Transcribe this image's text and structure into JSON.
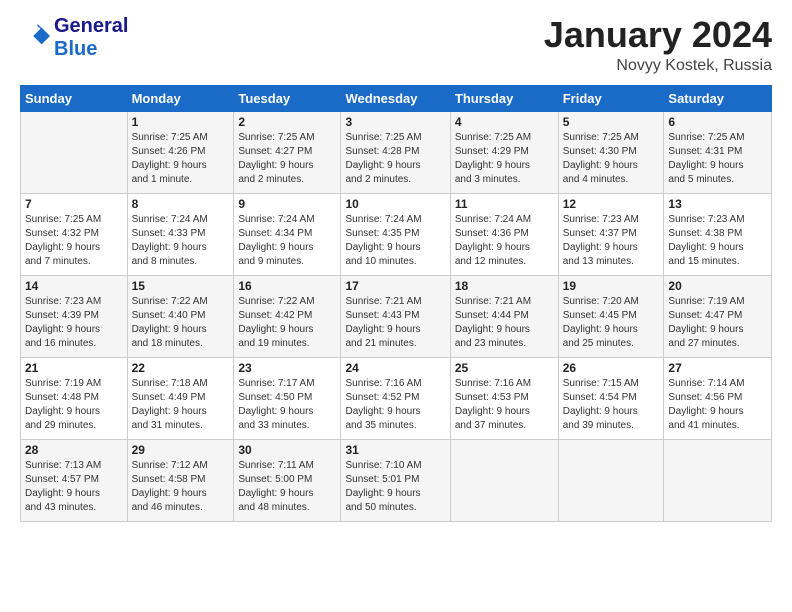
{
  "logo": {
    "line1": "General",
    "line2": "Blue"
  },
  "title": "January 2024",
  "subtitle": "Novyy Kostek, Russia",
  "header": {
    "days": [
      "Sunday",
      "Monday",
      "Tuesday",
      "Wednesday",
      "Thursday",
      "Friday",
      "Saturday"
    ]
  },
  "weeks": [
    [
      {
        "num": "",
        "detail": ""
      },
      {
        "num": "1",
        "detail": "Sunrise: 7:25 AM\nSunset: 4:26 PM\nDaylight: 9 hours\nand 1 minute."
      },
      {
        "num": "2",
        "detail": "Sunrise: 7:25 AM\nSunset: 4:27 PM\nDaylight: 9 hours\nand 2 minutes."
      },
      {
        "num": "3",
        "detail": "Sunrise: 7:25 AM\nSunset: 4:28 PM\nDaylight: 9 hours\nand 2 minutes."
      },
      {
        "num": "4",
        "detail": "Sunrise: 7:25 AM\nSunset: 4:29 PM\nDaylight: 9 hours\nand 3 minutes."
      },
      {
        "num": "5",
        "detail": "Sunrise: 7:25 AM\nSunset: 4:30 PM\nDaylight: 9 hours\nand 4 minutes."
      },
      {
        "num": "6",
        "detail": "Sunrise: 7:25 AM\nSunset: 4:31 PM\nDaylight: 9 hours\nand 5 minutes."
      }
    ],
    [
      {
        "num": "7",
        "detail": "Sunrise: 7:25 AM\nSunset: 4:32 PM\nDaylight: 9 hours\nand 7 minutes."
      },
      {
        "num": "8",
        "detail": "Sunrise: 7:24 AM\nSunset: 4:33 PM\nDaylight: 9 hours\nand 8 minutes."
      },
      {
        "num": "9",
        "detail": "Sunrise: 7:24 AM\nSunset: 4:34 PM\nDaylight: 9 hours\nand 9 minutes."
      },
      {
        "num": "10",
        "detail": "Sunrise: 7:24 AM\nSunset: 4:35 PM\nDaylight: 9 hours\nand 10 minutes."
      },
      {
        "num": "11",
        "detail": "Sunrise: 7:24 AM\nSunset: 4:36 PM\nDaylight: 9 hours\nand 12 minutes."
      },
      {
        "num": "12",
        "detail": "Sunrise: 7:23 AM\nSunset: 4:37 PM\nDaylight: 9 hours\nand 13 minutes."
      },
      {
        "num": "13",
        "detail": "Sunrise: 7:23 AM\nSunset: 4:38 PM\nDaylight: 9 hours\nand 15 minutes."
      }
    ],
    [
      {
        "num": "14",
        "detail": "Sunrise: 7:23 AM\nSunset: 4:39 PM\nDaylight: 9 hours\nand 16 minutes."
      },
      {
        "num": "15",
        "detail": "Sunrise: 7:22 AM\nSunset: 4:40 PM\nDaylight: 9 hours\nand 18 minutes."
      },
      {
        "num": "16",
        "detail": "Sunrise: 7:22 AM\nSunset: 4:42 PM\nDaylight: 9 hours\nand 19 minutes."
      },
      {
        "num": "17",
        "detail": "Sunrise: 7:21 AM\nSunset: 4:43 PM\nDaylight: 9 hours\nand 21 minutes."
      },
      {
        "num": "18",
        "detail": "Sunrise: 7:21 AM\nSunset: 4:44 PM\nDaylight: 9 hours\nand 23 minutes."
      },
      {
        "num": "19",
        "detail": "Sunrise: 7:20 AM\nSunset: 4:45 PM\nDaylight: 9 hours\nand 25 minutes."
      },
      {
        "num": "20",
        "detail": "Sunrise: 7:19 AM\nSunset: 4:47 PM\nDaylight: 9 hours\nand 27 minutes."
      }
    ],
    [
      {
        "num": "21",
        "detail": "Sunrise: 7:19 AM\nSunset: 4:48 PM\nDaylight: 9 hours\nand 29 minutes."
      },
      {
        "num": "22",
        "detail": "Sunrise: 7:18 AM\nSunset: 4:49 PM\nDaylight: 9 hours\nand 31 minutes."
      },
      {
        "num": "23",
        "detail": "Sunrise: 7:17 AM\nSunset: 4:50 PM\nDaylight: 9 hours\nand 33 minutes."
      },
      {
        "num": "24",
        "detail": "Sunrise: 7:16 AM\nSunset: 4:52 PM\nDaylight: 9 hours\nand 35 minutes."
      },
      {
        "num": "25",
        "detail": "Sunrise: 7:16 AM\nSunset: 4:53 PM\nDaylight: 9 hours\nand 37 minutes."
      },
      {
        "num": "26",
        "detail": "Sunrise: 7:15 AM\nSunset: 4:54 PM\nDaylight: 9 hours\nand 39 minutes."
      },
      {
        "num": "27",
        "detail": "Sunrise: 7:14 AM\nSunset: 4:56 PM\nDaylight: 9 hours\nand 41 minutes."
      }
    ],
    [
      {
        "num": "28",
        "detail": "Sunrise: 7:13 AM\nSunset: 4:57 PM\nDaylight: 9 hours\nand 43 minutes."
      },
      {
        "num": "29",
        "detail": "Sunrise: 7:12 AM\nSunset: 4:58 PM\nDaylight: 9 hours\nand 46 minutes."
      },
      {
        "num": "30",
        "detail": "Sunrise: 7:11 AM\nSunset: 5:00 PM\nDaylight: 9 hours\nand 48 minutes."
      },
      {
        "num": "31",
        "detail": "Sunrise: 7:10 AM\nSunset: 5:01 PM\nDaylight: 9 hours\nand 50 minutes."
      },
      {
        "num": "",
        "detail": ""
      },
      {
        "num": "",
        "detail": ""
      },
      {
        "num": "",
        "detail": ""
      }
    ]
  ]
}
